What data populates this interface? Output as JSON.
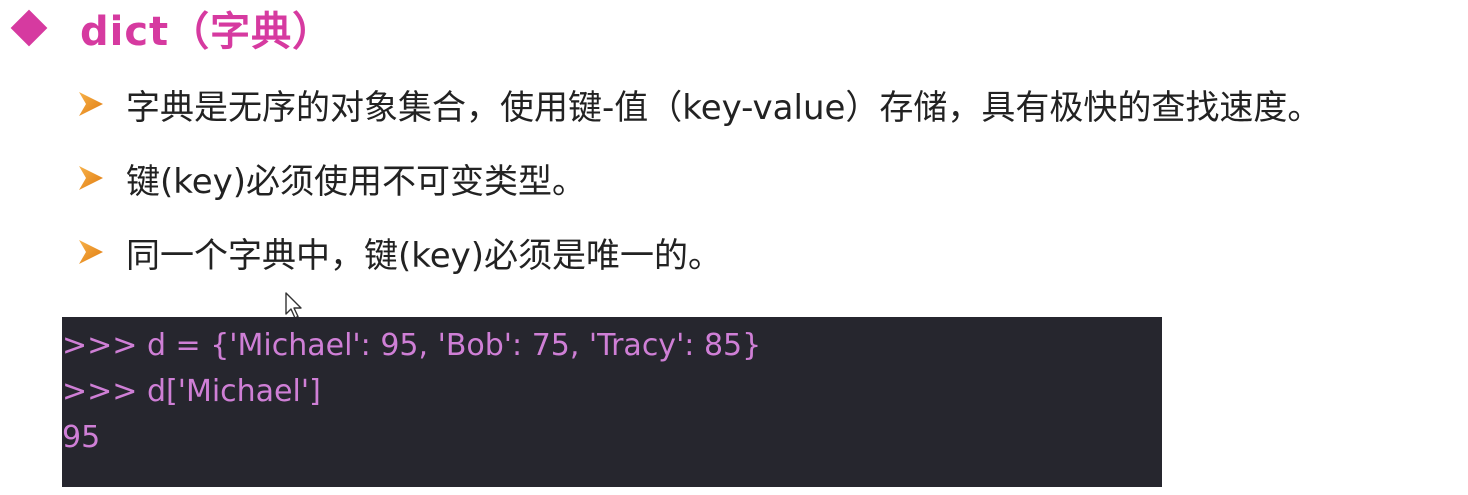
{
  "heading": {
    "title": "dict（字典）",
    "accent_color": "#d63aa0",
    "marker_icon": "diamond-icon"
  },
  "bullets": {
    "icon": "arrow-bullet-icon",
    "items": [
      {
        "text": "字典是无序的对象集合，使用键-值（key-value）存储，具有极快的查找速度。"
      },
      {
        "text": "键(key)必须使用不可变类型。"
      },
      {
        "text": "同一个字典中，键(key)必须是唯一的。"
      }
    ]
  },
  "code": {
    "background_color": "#26262e",
    "text_color": "#cf7fd6",
    "lines": [
      ">>> d = {'Michael': 95, 'Bob': 75, 'Tracy': 85}",
      ">>> d['Michael']",
      "95"
    ]
  },
  "cursor": {
    "icon": "mouse-pointer-icon"
  }
}
